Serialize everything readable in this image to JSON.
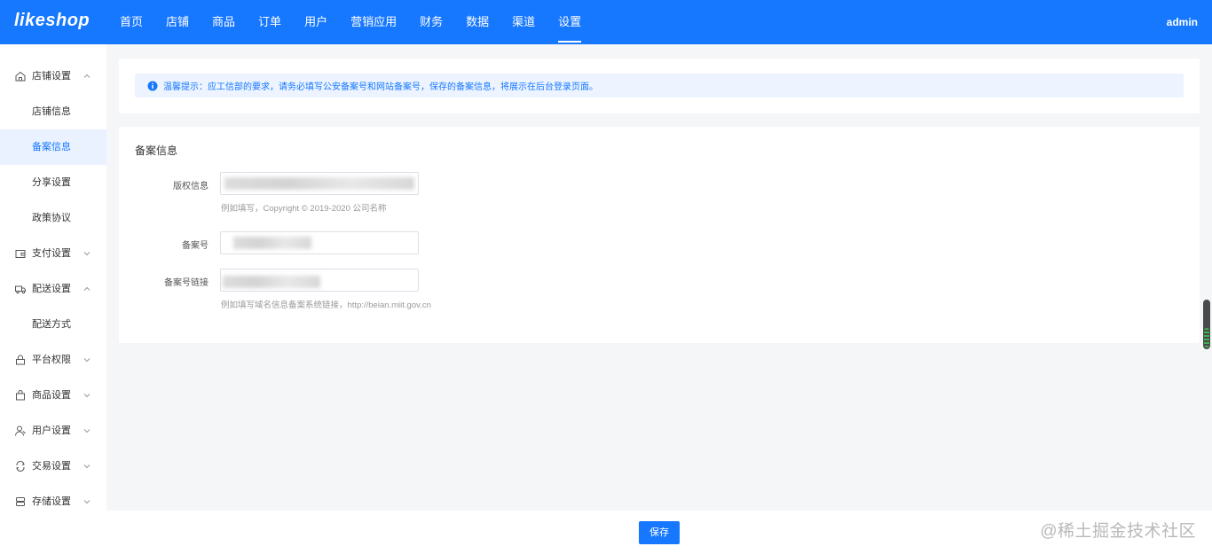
{
  "app": {
    "logo": "likeshop",
    "user": "admin"
  },
  "nav": {
    "items": [
      {
        "label": "首页"
      },
      {
        "label": "店铺"
      },
      {
        "label": "商品"
      },
      {
        "label": "订单"
      },
      {
        "label": "用户"
      },
      {
        "label": "营销应用"
      },
      {
        "label": "财务"
      },
      {
        "label": "数据"
      },
      {
        "label": "渠道"
      },
      {
        "label": "设置"
      }
    ],
    "active": "设置"
  },
  "sidebar": {
    "groups": [
      {
        "label": "店铺设置",
        "icon": "home-icon",
        "expanded": true
      },
      {
        "label": "支付设置",
        "icon": "wallet-icon",
        "expanded": false
      },
      {
        "label": "配送设置",
        "icon": "truck-icon",
        "expanded": true
      },
      {
        "label": "平台权限",
        "icon": "lock-icon",
        "expanded": false
      },
      {
        "label": "商品设置",
        "icon": "bag-icon",
        "expanded": false
      },
      {
        "label": "用户设置",
        "icon": "user-icon",
        "expanded": false
      },
      {
        "label": "交易设置",
        "icon": "exchange-icon",
        "expanded": false
      },
      {
        "label": "存储设置",
        "icon": "storage-icon",
        "expanded": false
      }
    ],
    "shop_items": [
      "店铺信息",
      "备案信息",
      "分享设置",
      "政策协议"
    ],
    "delivery_items": [
      "配送方式"
    ],
    "active_item": "备案信息"
  },
  "notice": {
    "text": "温馨提示：应工信部的要求，请务必填写公安备案号和网站备案号，保存的备案信息，将展示在后台登录页面。"
  },
  "form": {
    "section_title": "备案信息",
    "copyright_label": "版权信息",
    "copyright_hint": "例如填写，Copyright © 2019-2020 公司名称",
    "record_no_label": "备案号",
    "record_link_label": "备案号链接",
    "record_link_hint": "例如填写域名信息备案系统链接，http://beian.miit.gov.cn"
  },
  "footer": {
    "save_label": "保存",
    "watermark": "@稀土掘金技术社区"
  },
  "colors": {
    "primary": "#1677ff",
    "notice_bg": "#edf4ff",
    "page_bg": "#f5f6f8"
  }
}
